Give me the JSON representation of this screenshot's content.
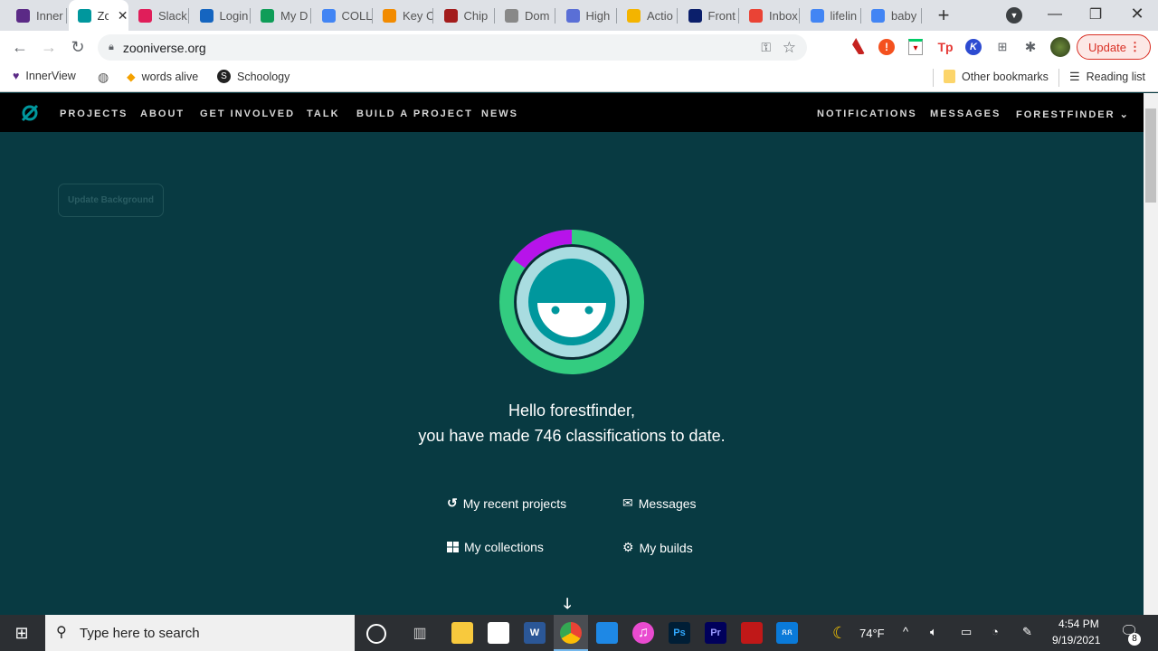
{
  "browser": {
    "tabs": [
      {
        "label": "Inner",
        "color": "#5b2a86"
      },
      {
        "label": "Zo",
        "color": "#00979d",
        "active": true
      },
      {
        "label": "Slack",
        "color": "#e01e5a"
      },
      {
        "label": "Login",
        "color": "#1565c0"
      },
      {
        "label": "My D",
        "color": "#0f9d58"
      },
      {
        "label": "COLL",
        "color": "#4285f4"
      },
      {
        "label": "Key C",
        "color": "#f28b00"
      },
      {
        "label": "Chip",
        "color": "#a31c1c"
      },
      {
        "label": "Dom",
        "color": "#888888"
      },
      {
        "label": "High",
        "color": "#5a6fd6"
      },
      {
        "label": "Actio",
        "color": "#f4b400"
      },
      {
        "label": "Front",
        "color": "#0b1f6b"
      },
      {
        "label": "Inbox",
        "color": "#ea4335"
      },
      {
        "label": "lifelin",
        "color": "#4285f4"
      },
      {
        "label": "baby",
        "color": "#4285f4"
      }
    ],
    "url": "zooniverse.org",
    "update_label": "Update",
    "bookmarks": [
      {
        "label": "InnerView"
      },
      {
        "label": ""
      },
      {
        "label": "words alive"
      },
      {
        "label": "Schoology"
      }
    ],
    "other_bookmarks": "Other bookmarks",
    "reading_list": "Reading list"
  },
  "nav": {
    "left": [
      "PROJECTS",
      "ABOUT",
      "GET INVOLVED",
      "TALK",
      "BUILD A PROJECT",
      "NEWS"
    ],
    "right": [
      "NOTIFICATIONS",
      "MESSAGES",
      "FORESTFINDER"
    ]
  },
  "main": {
    "update_background": "Update Background",
    "greeting": "Hello forestfinder,",
    "summary": "you have made 746 classifications to date.",
    "ring_progress_fraction": 0.15,
    "links": {
      "recent": "My recent projects",
      "messages": "Messages",
      "collections": "My collections",
      "builds": "My builds"
    }
  },
  "taskbar": {
    "search_placeholder": "Type here to search",
    "weather": "74°F",
    "time": "4:54 PM",
    "date": "9/19/2021",
    "notifications": "8"
  }
}
